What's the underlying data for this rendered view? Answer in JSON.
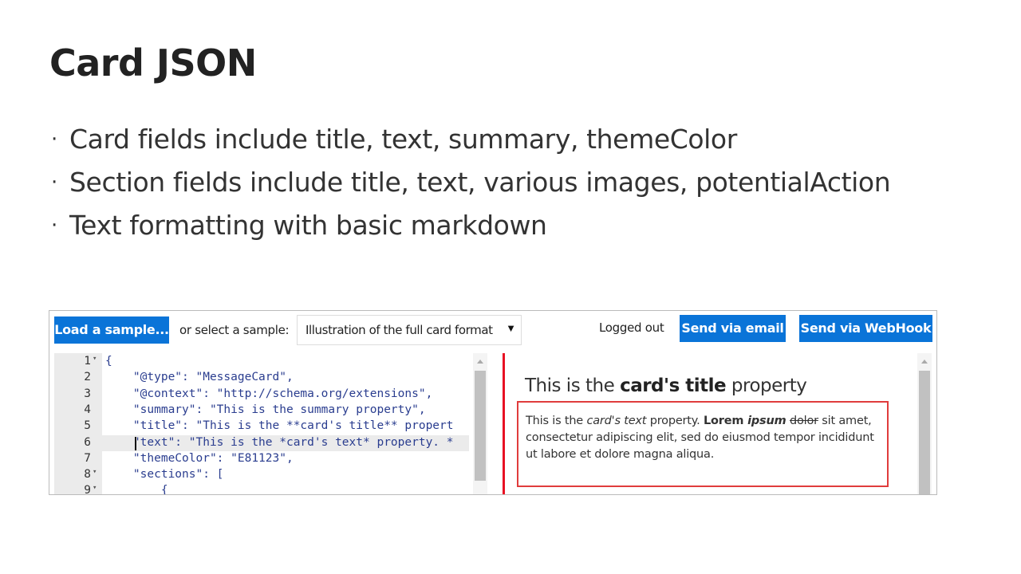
{
  "slide": {
    "title": "Card JSON",
    "bullets": [
      "Card fields include title, text, summary, themeColor",
      "Section fields include title, text, various images, potentialAction",
      "Text formatting with basic markdown"
    ],
    "bullet_glyph": "·"
  },
  "toolbar": {
    "load_label": "Load a sample...",
    "or_label": "or select a sample:",
    "select_value": "Illustration of the full card format",
    "select_arrow": "▼",
    "status": "Logged out",
    "email_label": "Send via email",
    "webhook_label": "Send via WebHook",
    "accent_color": "#0a74d8"
  },
  "editor": {
    "lines": [
      {
        "num": "1",
        "fold": "▾",
        "code": "{"
      },
      {
        "num": "2",
        "fold": "",
        "code": "    \"@type\": \"MessageCard\","
      },
      {
        "num": "3",
        "fold": "",
        "code": "    \"@context\": \"http://schema.org/extensions\","
      },
      {
        "num": "4",
        "fold": "",
        "code": "    \"summary\": \"This is the summary property\","
      },
      {
        "num": "5",
        "fold": "",
        "code": "    \"title\": \"This is the **card's title** propert"
      },
      {
        "num": "6",
        "fold": "",
        "code": "    \"text\": \"This is the *card's text* property. *"
      },
      {
        "num": "7",
        "fold": "",
        "code": "    \"themeColor\": \"E81123\","
      },
      {
        "num": "8",
        "fold": "▾",
        "code": "    \"sections\": ["
      },
      {
        "num": "9",
        "fold": "▾",
        "code": "        {"
      }
    ],
    "active_line": "6"
  },
  "preview": {
    "theme_color": "#e81123",
    "title_prefix": "This is the ",
    "title_bold": "card's title",
    "title_suffix": " property",
    "text_1": "This is the ",
    "text_italic": "card's text",
    "text_2": " property. ",
    "text_bold": "Lorem ",
    "text_bold_italic": "ipsum",
    "text_3": " ",
    "text_strike": "dolor",
    "text_4": " sit amet, consectetur adipiscing elit, sed do eiusmod tempor incididunt ut labore et dolore magna aliqua."
  }
}
